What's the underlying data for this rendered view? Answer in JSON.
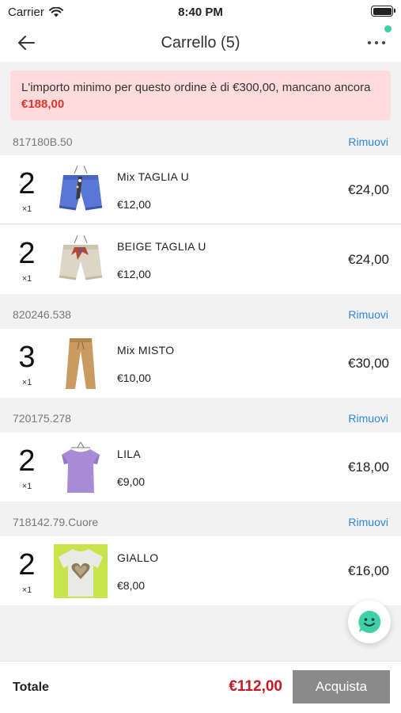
{
  "status_bar": {
    "carrier": "Carrier",
    "time": "8:40 PM"
  },
  "nav": {
    "title": "Carrello (5)"
  },
  "alert": {
    "message": "L'importo minimo per questo ordine è di €300,00, mancano ancora ",
    "amount": "€188,00"
  },
  "remove_label": "Rimuovi",
  "sections": [
    {
      "code": "817180B.50",
      "items": [
        {
          "qty": "2",
          "mult": "×1",
          "name": "Mix TAGLIA U",
          "price": "€12,00",
          "total": "€24,00",
          "image": "blue-shorts"
        },
        {
          "qty": "2",
          "mult": "×1",
          "name": "BEIGE TAGLIA U",
          "price": "€12,00",
          "total": "€24,00",
          "image": "beige-shorts"
        }
      ]
    },
    {
      "code": "820246.538",
      "items": [
        {
          "qty": "3",
          "mult": "×1",
          "name": "Mix MISTO",
          "price": "€10,00",
          "total": "€30,00",
          "image": "camel-pants"
        }
      ]
    },
    {
      "code": "720175.278",
      "items": [
        {
          "qty": "2",
          "mult": "×1",
          "name": "LILA",
          "price": "€9,00",
          "total": "€18,00",
          "image": "lilac-top"
        }
      ]
    },
    {
      "code": "718142.79.Cuore",
      "items": [
        {
          "qty": "2",
          "mult": "×1",
          "name": "GIALLO",
          "price": "€8,00",
          "total": "€16,00",
          "image": "heart-tshirt"
        }
      ]
    }
  ],
  "footer": {
    "total_label": "Totale",
    "total_value": "€112,00",
    "buy_label": "Acquista"
  },
  "colors": {
    "accent_link": "#2e86de",
    "total_red": "#c41a26",
    "alert_bg": "#ffdcdc",
    "alert_amount": "#e8312a",
    "buy_button": "#8a8a8a",
    "chat_green": "#3ed1a6"
  }
}
